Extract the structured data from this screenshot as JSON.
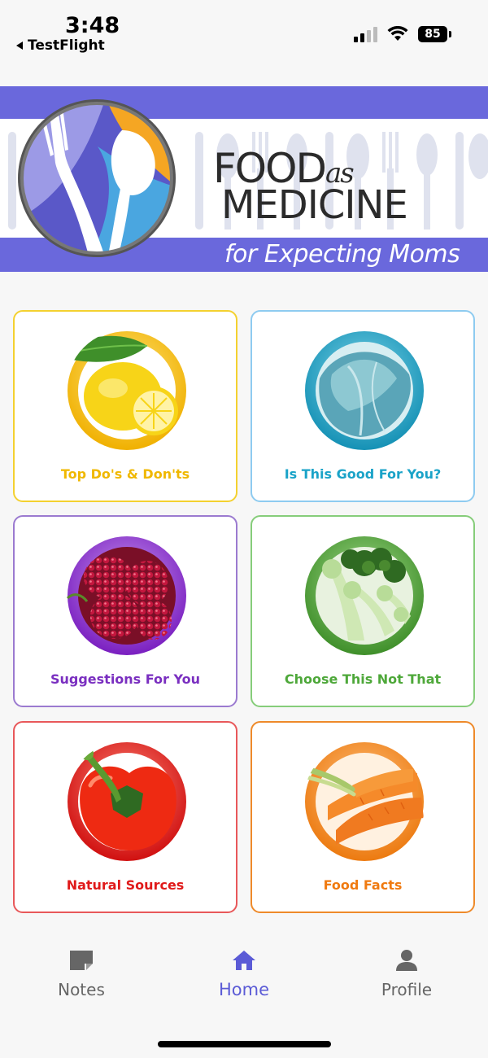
{
  "status_bar": {
    "time": "3:48",
    "back_app": "TestFlight",
    "battery": "85"
  },
  "banner": {
    "food": "FOOD",
    "as": "as",
    "medicine": "MEDICINE",
    "tagline": "for Expecting Moms",
    "accent_color": "#6a68dc"
  },
  "tiles": [
    {
      "label": "Top Do's & Don'ts",
      "color": "#f0b800",
      "icon": "lemon-icon"
    },
    {
      "label": "Is This Good For You?",
      "color": "#1aa3c8",
      "icon": "cabbage-icon"
    },
    {
      "label": "Suggestions For You",
      "color": "#7a2fc0",
      "icon": "raspberry-icon"
    },
    {
      "label": "Choose This Not That",
      "color": "#4ea83a",
      "icon": "broccoli-icon"
    },
    {
      "label": "Natural Sources",
      "color": "#e01a1a",
      "icon": "pepper-icon"
    },
    {
      "label": "Food Facts",
      "color": "#f07a10",
      "icon": "carrot-icon"
    }
  ],
  "tab_bar": {
    "items": [
      {
        "label": "Notes",
        "icon": "note-icon"
      },
      {
        "label": "Home",
        "icon": "home-icon",
        "active": true
      },
      {
        "label": "Profile",
        "icon": "person-icon"
      }
    ]
  }
}
